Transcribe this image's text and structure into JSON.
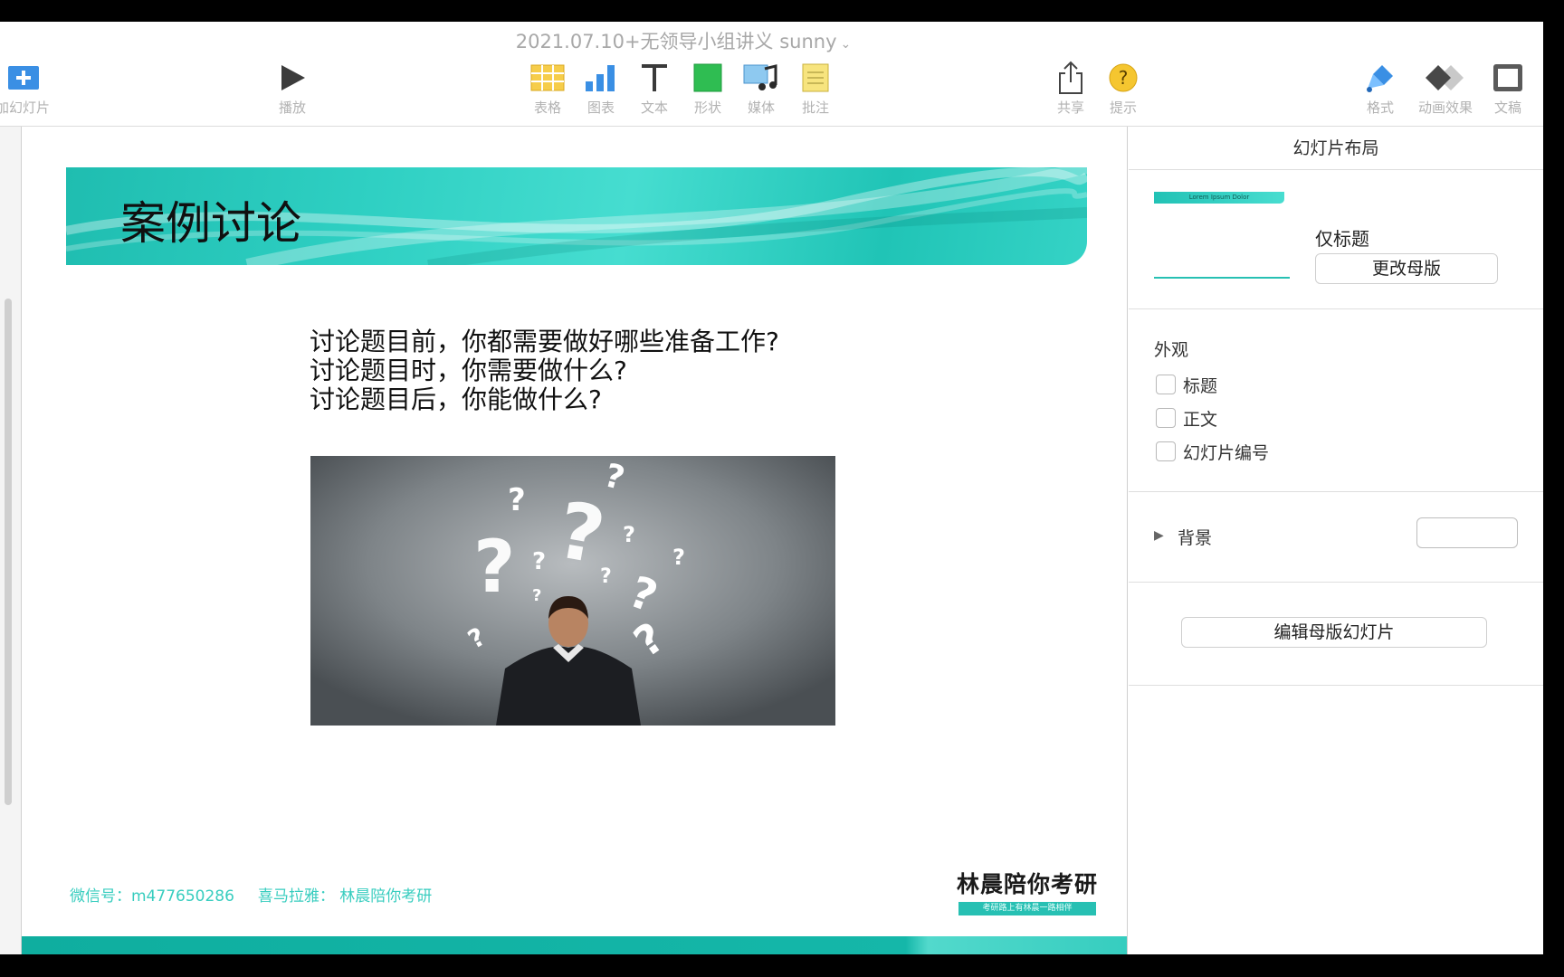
{
  "window": {
    "title": "2021.07.10+无领导小组讲义 sunny"
  },
  "toolbar": {
    "add_slide": "加幻灯片",
    "play": "播放",
    "table": "表格",
    "chart": "图表",
    "text": "文本",
    "shape": "形状",
    "media": "媒体",
    "comment": "批注",
    "share": "共享",
    "tips": "提示",
    "format": "格式",
    "animate": "动画效果",
    "document": "文稿"
  },
  "slide": {
    "title": "案例讨论",
    "lines": [
      "讨论题目前，你都需要做好哪些准备工作?",
      "讨论题目时，你需要做什么?",
      "讨论题目后，你能做什么?"
    ],
    "footer": {
      "wechat": "微信号：m477650286",
      "ximalaya": "喜马拉雅：  林晨陪你考研"
    },
    "logo": {
      "main": "林晨陪你考研",
      "sub": "考研路上有林晨一路相伴"
    }
  },
  "inspector": {
    "header": "幻灯片布局",
    "layout_thumb_title": "Lorem Ipsum Dolor",
    "layout_name": "仅标题",
    "change_master": "更改母版",
    "appearance_title": "外观",
    "checkboxes": [
      {
        "label": "标题",
        "checked": false
      },
      {
        "label": "正文",
        "checked": false
      },
      {
        "label": "幻灯片编号",
        "checked": false
      }
    ],
    "background_label": "背景",
    "edit_master": "编辑母版幻灯片"
  },
  "colors": {
    "accent": "#27c0b3",
    "toolbar_label": "#b2b2b2",
    "footer_text": "#38cdbf"
  },
  "icons": [
    "add-slide-icon",
    "play-icon",
    "table-icon",
    "chart-icon",
    "text-icon",
    "shape-icon",
    "media-icon",
    "comment-icon",
    "share-icon",
    "tips-icon",
    "format-icon",
    "animate-icon",
    "document-icon"
  ]
}
